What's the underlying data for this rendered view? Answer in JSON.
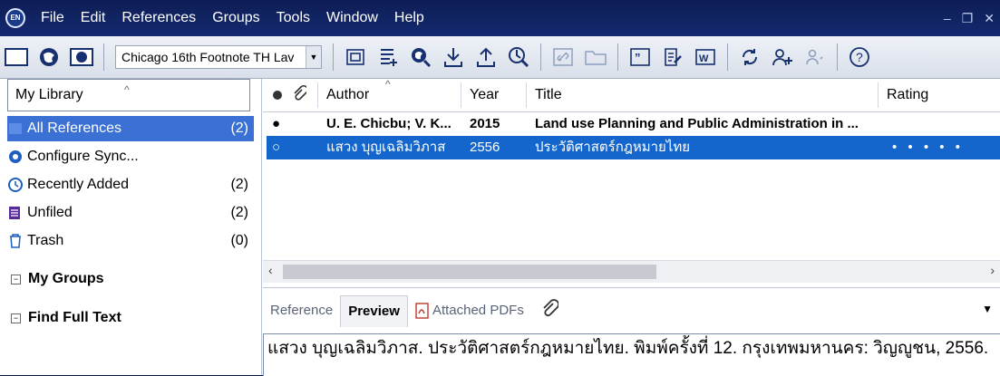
{
  "menu": {
    "items": [
      "File",
      "Edit",
      "References",
      "Groups",
      "Tools",
      "Window",
      "Help"
    ],
    "logo_text": "EN"
  },
  "toolbar": {
    "output_style": "Chicago 16th Footnote TH Lav"
  },
  "sidebar": {
    "library_label": "My Library",
    "groups": [
      {
        "label": "All References",
        "count": "(2)",
        "icon": "stack-icon"
      },
      {
        "label": "Configure Sync...",
        "count": "",
        "icon": "sync-icon"
      },
      {
        "label": "Recently Added",
        "count": "(2)",
        "icon": "clock-icon"
      },
      {
        "label": "Unfiled",
        "count": "(2)",
        "icon": "unfiled-icon"
      },
      {
        "label": "Trash",
        "count": "(0)",
        "icon": "trash-icon"
      }
    ],
    "sections": [
      {
        "label": "My Groups"
      },
      {
        "label": "Find Full Text"
      }
    ]
  },
  "references": {
    "columns": {
      "author": "Author",
      "year": "Year",
      "title": "Title",
      "rating": "Rating"
    },
    "rows": [
      {
        "author": "U. E. Chicbu; V. K...",
        "year": "2015",
        "title": "Land use Planning and Public Administration in ...",
        "rating": ""
      },
      {
        "author": "แสวง บุญเฉลิมวิภาส",
        "year": "2556",
        "title": "ประวัติศาสตร์กฎหมายไทย",
        "rating": "• • • • •"
      }
    ]
  },
  "preview": {
    "tabs": {
      "reference": "Reference",
      "preview": "Preview",
      "attached": "Attached PDFs"
    },
    "citation": "แสวง บุญเฉลิมวิภาส. ประวัติศาสตร์กฎหมายไทย. พิมพ์ครั้งที่ 12. กรุงเทพมหานคร: วิญญูชน, 2556."
  },
  "colors": {
    "selection": "#1566cc",
    "group_selection": "#3b71d4",
    "menubar": "#0e1d55"
  }
}
